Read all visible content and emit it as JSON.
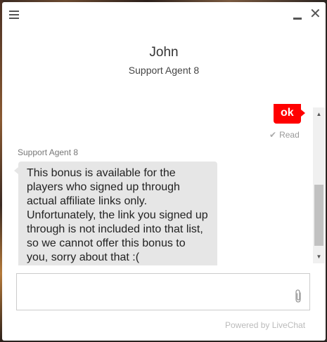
{
  "header": {
    "agent_name": "John",
    "agent_title": "Support Agent 8"
  },
  "messages": {
    "outgoing": {
      "text": "ok",
      "status": "Read"
    },
    "incoming": {
      "sender": "Support Agent 8",
      "text": "This bonus is available for the players who signed up through actual affiliate links only. Unfortunately, the link you signed up through is not included into that list, so we cannot offer this bonus to you, sorry about that :("
    }
  },
  "composer": {
    "placeholder": "",
    "value": ""
  },
  "footer": {
    "powered_by": "Powered by LiveChat"
  },
  "colors": {
    "accent": "#ff0000",
    "incoming_bubble": "#e6e6e6"
  },
  "icons": {
    "menu": "hamburger-menu-icon",
    "minimize": "minimize-icon",
    "close": "close-icon",
    "read": "check-icon",
    "attach": "paperclip-icon",
    "scroll_up": "scroll-up-arrow-icon",
    "scroll_down": "scroll-down-arrow-icon"
  }
}
